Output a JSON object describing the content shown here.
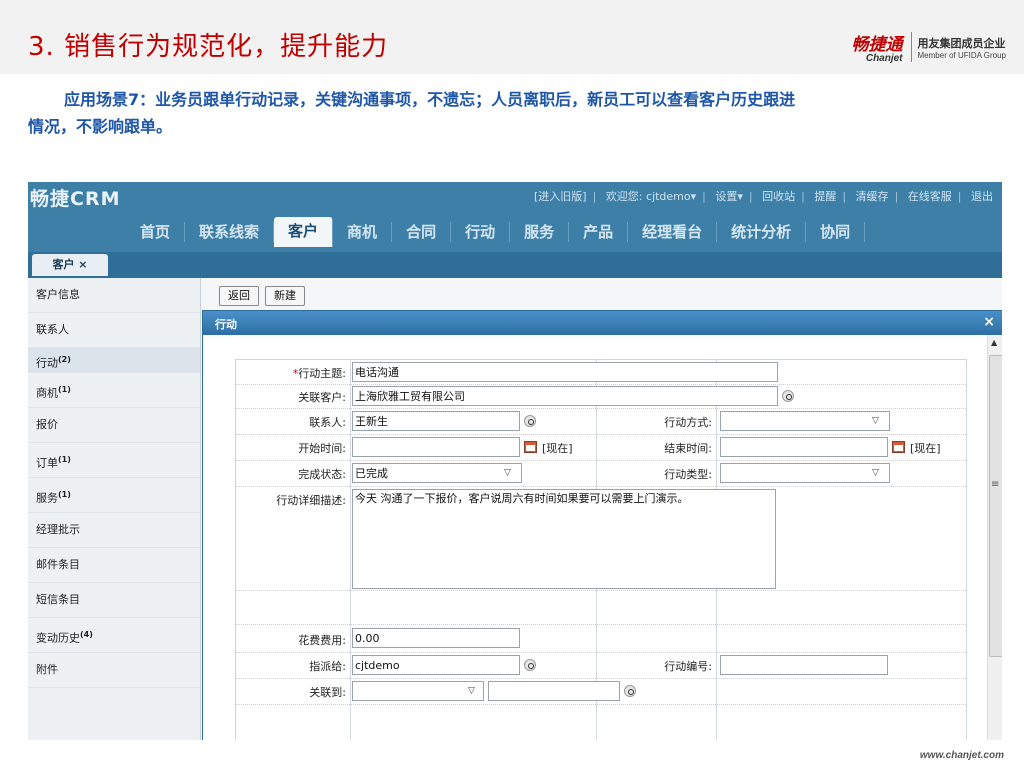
{
  "slide": {
    "title": "3. 销售行为规范化，提升能力",
    "brand_cn": "畅捷通",
    "brand_en": "Chanjet",
    "member_cn": "用友集团成员企业",
    "member_en": "Member of UFIDA Group",
    "intro_line1": "应用场景7：业务员跟单行动记录，关键沟通事项，不遗忘；人员离职后，新员工可以查看客户历史跟进",
    "intro_line2": "情况，不影响跟单。",
    "footer_url": "www.chanjet.com"
  },
  "crm": {
    "logo": "畅捷CRM",
    "top_links": [
      "[进入旧版]",
      "欢迎您: cjtdemo▾",
      "设置▾",
      "回收站",
      "提醒",
      "清缓存",
      "在线客服",
      "退出"
    ],
    "nav": [
      "首页",
      "联系线索",
      "客户",
      "商机",
      "合同",
      "行动",
      "服务",
      "产品",
      "经理看台",
      "统计分析",
      "协同"
    ],
    "active_nav": "客户",
    "tab": "客户 ×",
    "sidebar": [
      {
        "label": "客户信息",
        "sup": ""
      },
      {
        "label": "联系人",
        "sup": ""
      },
      {
        "label": "行动",
        "sup": "(2)"
      },
      {
        "label": "商机",
        "sup": "(1)"
      },
      {
        "label": "报价",
        "sup": ""
      },
      {
        "label": "订单",
        "sup": "(1)"
      },
      {
        "label": "服务",
        "sup": "(1)"
      },
      {
        "label": "经理批示",
        "sup": ""
      },
      {
        "label": "邮件条目",
        "sup": ""
      },
      {
        "label": "短信条目",
        "sup": ""
      },
      {
        "label": "变动历史",
        "sup": "(4)"
      },
      {
        "label": "附件",
        "sup": ""
      }
    ],
    "buttons": {
      "back": "返回",
      "new": "新建"
    },
    "dialog": {
      "title": "行动",
      "close": "×",
      "labels": {
        "subject": "行动主题:",
        "customer": "关联客户:",
        "contact": "联系人:",
        "method": "行动方式:",
        "start": "开始时间:",
        "end": "结束时间:",
        "status": "完成状态:",
        "type": "行动类型:",
        "detail": "行动详细描述:",
        "cost": "花费费用:",
        "assign": "指派给:",
        "code": "行动编号:",
        "link": "关联到:"
      },
      "required_mark": "*",
      "now_label": "[现在]",
      "values": {
        "subject": "电话沟通",
        "customer": "上海欣雅工贸有限公司",
        "contact": "王新生",
        "method": "",
        "start": "",
        "end": "",
        "status": "已完成",
        "type": "",
        "detail": "今天 沟通了一下报价，客户说周六有时间如果要可以需要上门演示。",
        "cost": "0.00",
        "assign": "cjtdemo",
        "code": "",
        "link": ""
      }
    }
  }
}
